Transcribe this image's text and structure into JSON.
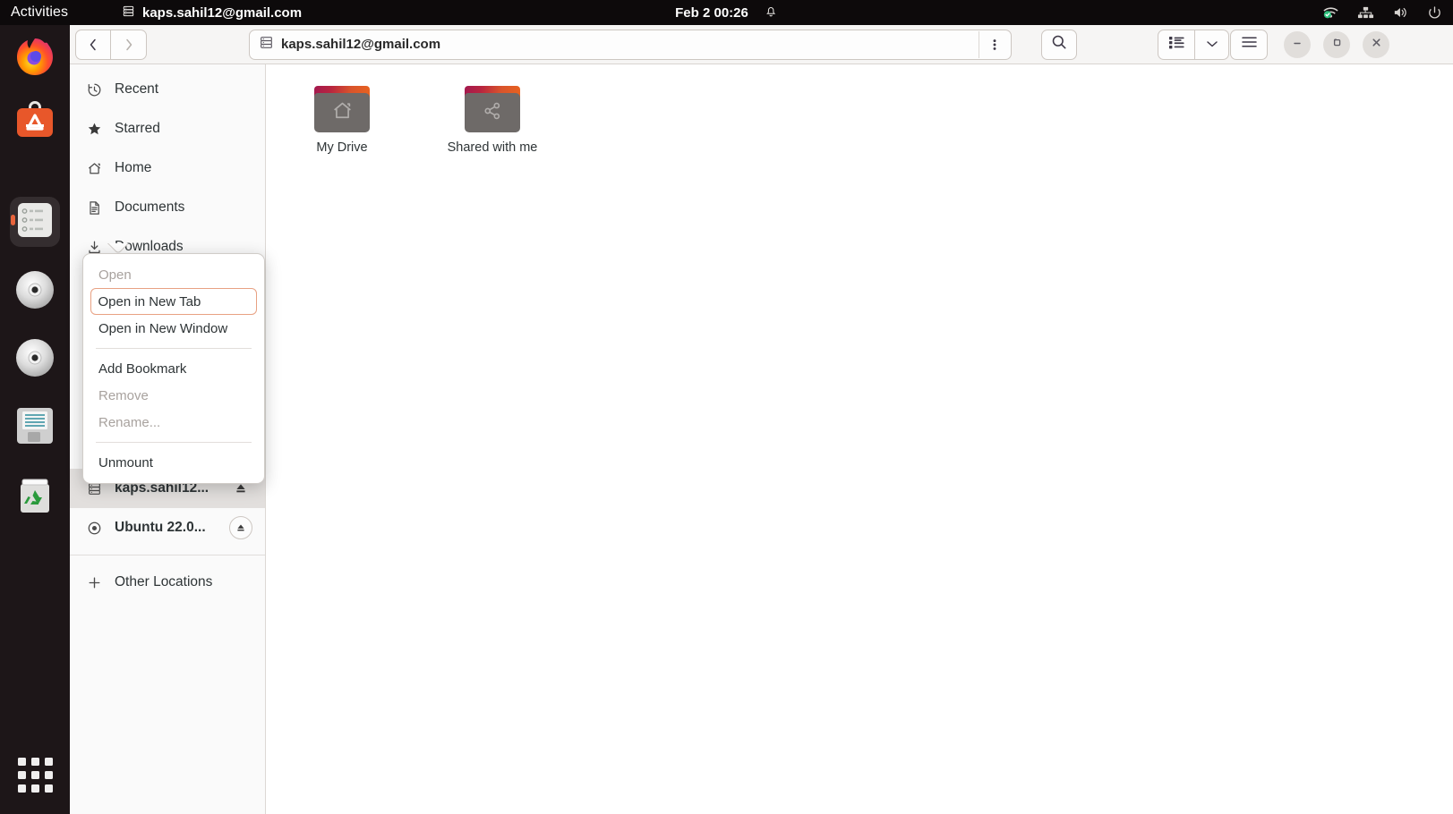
{
  "topbar": {
    "activities": "Activities",
    "app_name": "kaps.sahil12@gmail.com",
    "app_icon": "drive-icon",
    "clock": "Feb 2  00:26",
    "notification_icon": "bell-icon",
    "tray": [
      {
        "name": "wifi-icon"
      },
      {
        "name": "network-wired-icon"
      },
      {
        "name": "volume-icon"
      },
      {
        "name": "power-icon"
      }
    ]
  },
  "dock": {
    "items": [
      {
        "name": "firefox-icon",
        "label": "Firefox",
        "active": false
      },
      {
        "name": "ubuntu-software-icon",
        "label": "Ubuntu Software",
        "active": false
      },
      {
        "name": "files-icon",
        "label": "Files",
        "active": true
      },
      {
        "name": "cd-drive-icon",
        "label": "CD Drive",
        "active": false
      },
      {
        "name": "cd-drive-icon-2",
        "label": "CD Drive",
        "active": false
      },
      {
        "name": "disk-icon",
        "label": "Disk",
        "active": false
      },
      {
        "name": "trash-icon",
        "label": "Trash",
        "active": false
      }
    ],
    "app_grid": "show-applications"
  },
  "headerbar": {
    "back_icon": "chevron-left-icon",
    "forward_icon": "chevron-right-icon",
    "path_icon": "drive-icon",
    "path_value": "kaps.sahil12@gmail.com",
    "path_kebab_icon": "kebab-menu-icon",
    "search_icon": "search-icon",
    "view_list_icon": "list-view-icon",
    "view_dropdown_icon": "chevron-down-icon",
    "main_menu_icon": "hamburger-menu-icon",
    "minimize_icon": "minimize-icon",
    "maximize_icon": "maximize-icon",
    "close_icon": "close-icon"
  },
  "sidebar": {
    "items": [
      {
        "label": "Recent",
        "icon": "clock-icon",
        "selected": false,
        "eject": "none"
      },
      {
        "label": "Starred",
        "icon": "star-icon",
        "selected": false,
        "eject": "none"
      },
      {
        "label": "Home",
        "icon": "home-icon",
        "selected": false,
        "eject": "none"
      },
      {
        "label": "Documents",
        "icon": "document-icon",
        "selected": false,
        "eject": "none"
      },
      {
        "label": "Downloads",
        "icon": "download-icon",
        "selected": false,
        "eject": "none"
      },
      {
        "label": "kaps.sahil12...",
        "icon": "drive-icon",
        "selected": true,
        "eject": "plain"
      },
      {
        "label": "Ubuntu 22.0...",
        "icon": "disc-icon",
        "selected": false,
        "eject": "button"
      },
      {
        "label": "Other Locations",
        "icon": "plus-icon",
        "selected": false,
        "eject": "none"
      }
    ]
  },
  "context_menu": {
    "items": [
      {
        "label": "Open",
        "state": "disabled"
      },
      {
        "label": "Open in New Tab",
        "state": "focused"
      },
      {
        "label": "Open in New Window",
        "state": "normal"
      },
      {
        "label": "Add Bookmark",
        "state": "normal"
      },
      {
        "label": "Remove",
        "state": "disabled"
      },
      {
        "label": "Rename...",
        "state": "disabled"
      },
      {
        "label": "Unmount",
        "state": "normal"
      }
    ]
  },
  "content": {
    "files": [
      {
        "name": "My Drive",
        "emblem": "home-emblem-icon"
      },
      {
        "name": "Shared with me",
        "emblem": "share-emblem-icon"
      }
    ]
  },
  "colors": {
    "accent": "#e8643c",
    "focus_outline": "#e8a183",
    "topbar_bg": "#0d0a0b",
    "dock_bg": "#1d1618",
    "sidebar_bg": "#fafafa",
    "selected_row": "#e2dfdd"
  }
}
